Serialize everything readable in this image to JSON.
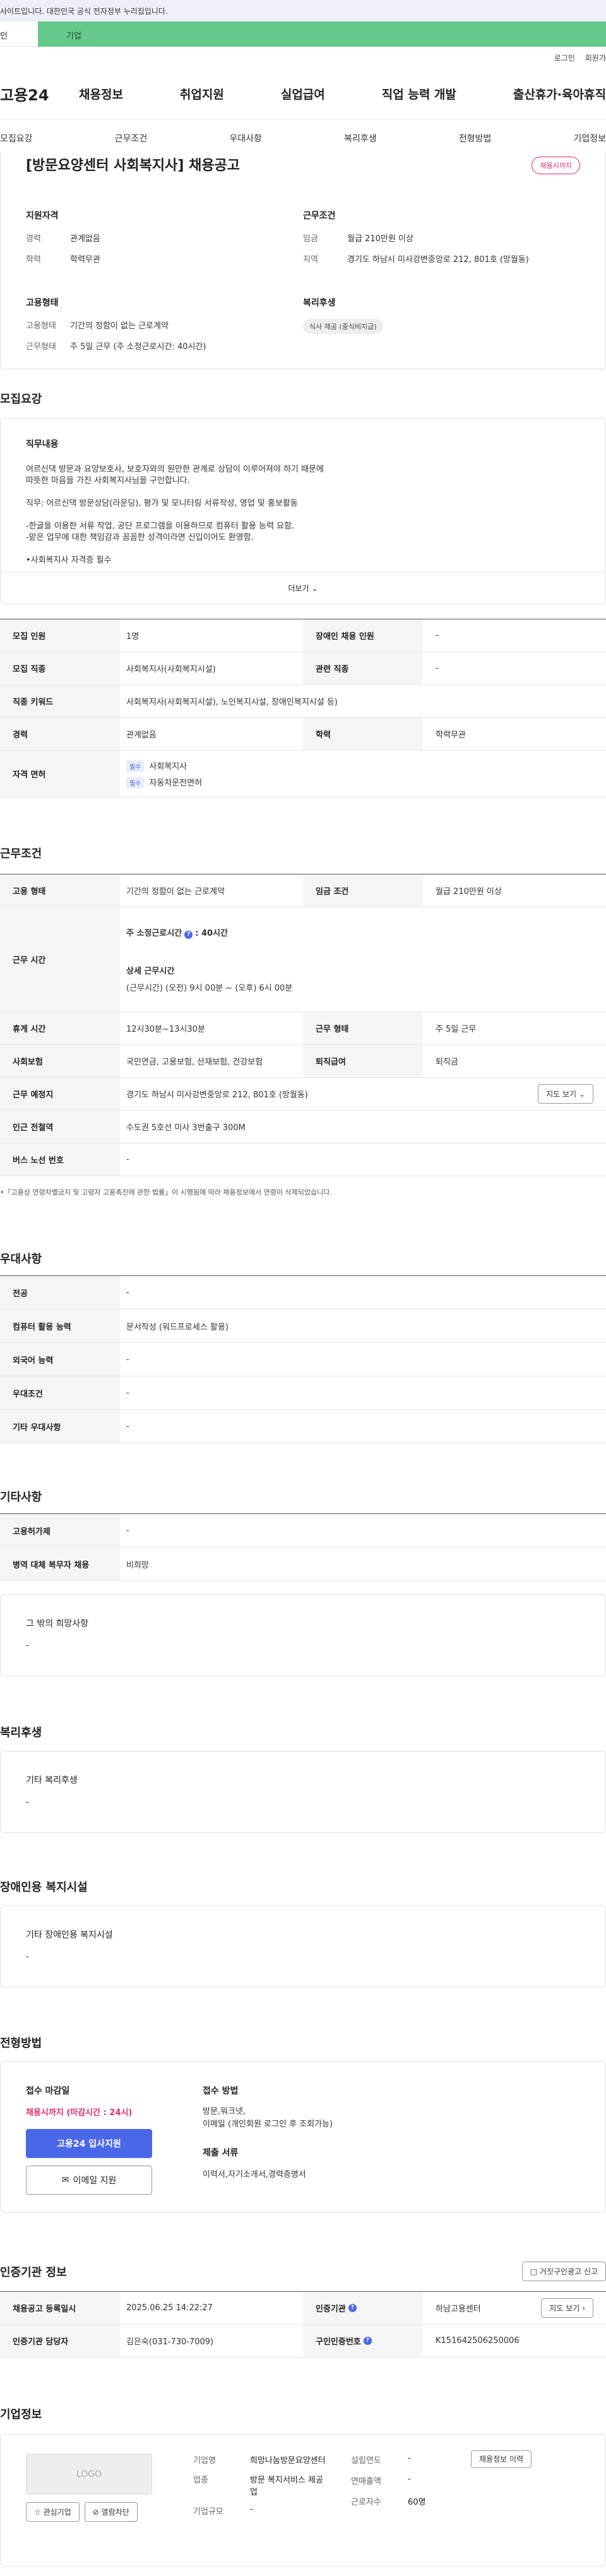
{
  "top": {
    "notice": "사이트입니다. 대한민국 공식 전자정부 누리집입니다.",
    "tab_left": "인",
    "tab_right": "기업",
    "util": [
      "로그인",
      "회원가"
    ]
  },
  "gnb": {
    "logo": "고용24",
    "menu": [
      "채용정보",
      "취업지원",
      "실업급여",
      "직업 능력 개발",
      "출산휴가·육아휴직"
    ]
  },
  "subtabs": [
    "모집요강",
    "근무조건",
    "우대사항",
    "복리후생",
    "전형방법",
    "기업정보"
  ],
  "job": {
    "title": "[방문요양센터 사회복지사] 채용공고",
    "status_badge": "채용시까지",
    "support_title": "지원자격",
    "support": [
      {
        "k": "경력",
        "v": "관계없음"
      },
      {
        "k": "학력",
        "v": "학력무관"
      }
    ],
    "work_title": "근무조건",
    "work": [
      {
        "k": "임금",
        "v": "월급 210만원 이상"
      },
      {
        "k": "지역",
        "v": "경기도 하남시 미사강변중앙로 212, 801호 (망월동)"
      }
    ],
    "employ_title": "고용형태",
    "employ": [
      {
        "k": "고용형태",
        "v": "기간의 정함이 없는 근로계약"
      },
      {
        "k": "근무형태",
        "v": "주 5일 근무 (주 소정근로시간: 40시간)"
      }
    ],
    "welfare_title": "복리후생",
    "welfare_pill": "식사 제공 (중식비지급)"
  },
  "recruit": {
    "section_title": "모집요강",
    "duty_title": "직무내용",
    "duty_lines": [
      "어르신댁 방문과 요양보호사, 보호자와의 원만한 관계로 상담이 이루어져야 하기 때문에",
      "따뜻한 마음을 가진 사회복지사님을 구인합니다.",
      "",
      "직무: 어르신댁 방문상담(라운딩), 평가 및 모니터링 서류작성, 영업 및 홍보활동",
      "",
      "-한글을 이용한 서류 작업, 공단 프로그램을 이용하므로 컴퓨터 활용 능력 요함.",
      "-맡은 업무에 대한 책임감과 꼼꼼한 성격이라면 신입이어도 환영함.",
      "",
      "•사회복지사 자격증 필수"
    ],
    "more": "더보기",
    "table": [
      {
        "th": "모집 인원",
        "td": "1명",
        "th2": "장애인 채용 인원",
        "td2": "-"
      },
      {
        "th": "모집 직종",
        "td": "사회복지사(사회복지시설)",
        "th2": "관련 직종",
        "td2": "-"
      },
      {
        "th": "직종 키워드",
        "td": "사회복지사(사회복지시설), 노인복지시설, 장애인복지시설 등)"
      },
      {
        "th": "경력",
        "td": "관계없음",
        "th2": "학력",
        "td2": "학력무관"
      }
    ],
    "license_th": "자격 면허",
    "licenses": [
      {
        "tag": "필수",
        "name": "사회복지사"
      },
      {
        "tag": "필수",
        "name": "자동차운전면허"
      }
    ]
  },
  "work": {
    "section_title": "근무조건",
    "employ_th": "고용 형태",
    "employ_td": "기간의 정함이 없는 근로계약",
    "wage_th": "임금 조건",
    "wage_td": "월급 210만원 이상",
    "hours_th": "근무 시간",
    "hours_weekly": "주 소정근로시간",
    "hours_weekly_val": ": 40시간",
    "hours_detail_title": "상세 근무시간",
    "hours_detail": "(근무시간) (오전) 9시 00분 ~ (오후) 6시 00분",
    "rows": [
      {
        "th": "휴게 시간",
        "td": "12시30분~13시30분",
        "th2": "근무 형태",
        "td2": "주 5일 근무"
      },
      {
        "th": "사회보험",
        "td": "국민연금, 고용보험, 산재보험, 건강보험",
        "th2": "퇴직급여",
        "td2": "퇴직금"
      }
    ],
    "place_th": "근무 예정지",
    "place_td": "경기도 하남시 미사강변중앙로 212, 801호 (망월동)",
    "map_btn": "지도 보기",
    "station_th": "인근 전철역",
    "station_td": "수도권 5호선 미사 3번출구 300M",
    "bus_th": "버스 노선 번호",
    "bus_td": "-",
    "note": "•「고용상 연령차별금지 및 고령자 고용촉진에 관한 법률」이 시행됨에 따라 채용정보에서 연령이 삭제되었습니다."
  },
  "pref": {
    "section_title": "우대사항",
    "rows": [
      {
        "th": "전공",
        "td": "-"
      },
      {
        "th": "컴퓨터 활용 능력",
        "td": "문서작성 (워드프로세스 활용)"
      },
      {
        "th": "외국어 능력",
        "td": "-"
      },
      {
        "th": "우대조건",
        "td": "-"
      },
      {
        "th": "기타 우대사항",
        "td": "-"
      }
    ]
  },
  "etc": {
    "section_title": "기타사항",
    "rows": [
      {
        "th": "고용허가제",
        "td": "-"
      },
      {
        "th": "병역 대체 복무자 채용",
        "td": "비희망"
      }
    ],
    "other_title": "그 밖의 희망사항",
    "other_val": "-"
  },
  "welfare": {
    "section_title": "복리후생",
    "box_title": "기타 복리후생",
    "box_val": "-"
  },
  "facility": {
    "section_title": "장애인용 복지시설",
    "box_title": "기타 장애인용 복지시설",
    "box_val": "-"
  },
  "screen": {
    "section_title": "전형방법",
    "deadline_title": "접수 마감일",
    "deadline_val": "채용시까지 (마감시간 : 24시)",
    "apply_btn": "고용24 입사지원",
    "email_btn": "이메일 지원",
    "method_title": "접수 방법",
    "method_lines": [
      "방문,워크넷,",
      "이메일 (개인회원 로그인 후 조회가능)"
    ],
    "docs_title": "제출 서류",
    "docs_val": "이력서,자기소개서,경력증명서"
  },
  "auth": {
    "section_title": "인증기관 정보",
    "report_btn": "거짓구인광고 신고",
    "rows": [
      {
        "th": "채용공고 등록일시",
        "td": "2025.06.25 14:22:27",
        "th2": "인증기관",
        "td2": "하남고용센터",
        "btn": "지도 보기"
      },
      {
        "th": "인증기관 담당자",
        "td": "김은숙(031-730-7009)",
        "th2": "구인인증번호",
        "td2": "K151642506250006"
      }
    ]
  },
  "company": {
    "section_title": "기업정보",
    "logo": "LOGO",
    "fav_btn": "관심기업",
    "block_btn": "열람차단",
    "name_k": "기업명",
    "name_v": "희망나눔방문요양센터",
    "industry_k": "업종",
    "industry_v": "방문 복지서비스 제공업",
    "size_k": "기업규모",
    "size_v": "-",
    "founded_k": "설립연도",
    "founded_v": "-",
    "sales_k": "연매출액",
    "sales_v": "-",
    "staff_k": "근로자수",
    "staff_v": "60명",
    "history_btn": "채용정보 이력"
  }
}
